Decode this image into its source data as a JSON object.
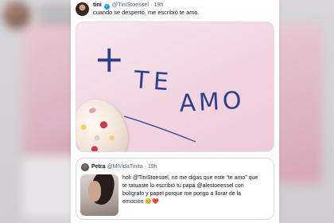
{
  "tweet": {
    "name": "tini",
    "handle": "@TiniStoessel",
    "separator": "·",
    "time": "19h",
    "text": "cuando se despertó, me escribió te amo.",
    "media": {
      "handwriting_1": "+",
      "handwriting_2": "TE",
      "handwriting_3": "AMO"
    }
  },
  "quote": {
    "name": "Petra",
    "handle": "@MiVidaTinita",
    "separator": "·",
    "time": "19h",
    "lines": [
      "holi @TiniStoessel, no me digas que este “te amo” que",
      "te tatuaste lo escribió tu papá @alestoeessel con",
      "bolígrafo y papel porque me pongo a llorar de la",
      "emoción 🥺❤️"
    ]
  },
  "colors": {
    "verified": "#1d9bf0",
    "paper": "#f2d8e3",
    "ink": "#2f3f8a"
  },
  "icons": [
    "verified-badge-icon"
  ]
}
